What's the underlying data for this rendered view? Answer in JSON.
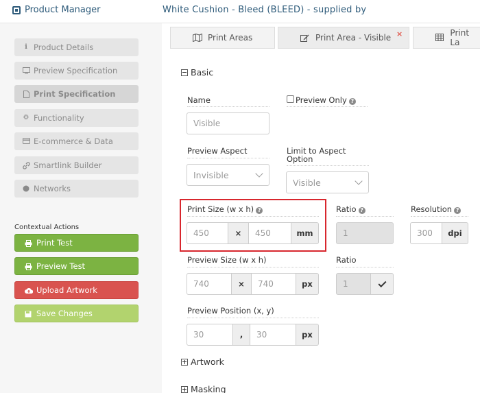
{
  "header": {
    "app_title": "Product Manager",
    "product_title": "White Cushion - Bleed (BLEED) - supplied by"
  },
  "sidebar": {
    "items": [
      {
        "label": "Product Details"
      },
      {
        "label": "Preview Specification"
      },
      {
        "label": "Print Specification"
      },
      {
        "label": "Functionality"
      },
      {
        "label": "E-commerce & Data"
      },
      {
        "label": "Smartlink Builder"
      },
      {
        "label": "Networks"
      }
    ],
    "contextual_label": "Contextual Actions",
    "actions": [
      {
        "label": "Print Test"
      },
      {
        "label": "Preview Test"
      },
      {
        "label": "Upload Artwork"
      },
      {
        "label": "Save Changes"
      }
    ]
  },
  "tabs": [
    {
      "label": "Print Areas"
    },
    {
      "label": "Print Area - Visible"
    },
    {
      "label": "Print La"
    }
  ],
  "tab_close": "×",
  "sections": {
    "basic": "Basic",
    "artwork": "Artwork",
    "masking": "Masking"
  },
  "form": {
    "name_label": "Name",
    "name_placeholder": "Visible",
    "preview_only_label": "Preview Only",
    "preview_aspect_label": "Preview Aspect",
    "preview_aspect_value": "Invisible",
    "limit_aspect_label_1": "Limit to Aspect",
    "limit_aspect_label_2": "Option",
    "limit_aspect_value": "Visible",
    "print_size_label": "Print Size (w x h)",
    "print_w": "450",
    "print_h": "450",
    "print_sep": "×",
    "print_unit": "mm",
    "ratio_label": "Ratio",
    "ratio_value": "1",
    "resolution_label": "Resolution",
    "resolution_value": "300",
    "resolution_unit": "dpi",
    "preview_size_label": "Preview Size (w x h)",
    "preview_w": "740",
    "preview_h": "740",
    "preview_sep": "×",
    "preview_unit": "px",
    "ratio2_label": "Ratio",
    "ratio2_value": "1",
    "preview_pos_label": "Preview Position (x, y)",
    "pos_x": "30",
    "pos_y": "30",
    "pos_sep": ",",
    "pos_unit": "px"
  },
  "help_glyph": "?",
  "colors": {
    "header_text": "#2e5b7a",
    "green": "#7cb342",
    "red": "#d9534f",
    "light_green": "#b2d36e",
    "highlight": "#d8262d"
  }
}
